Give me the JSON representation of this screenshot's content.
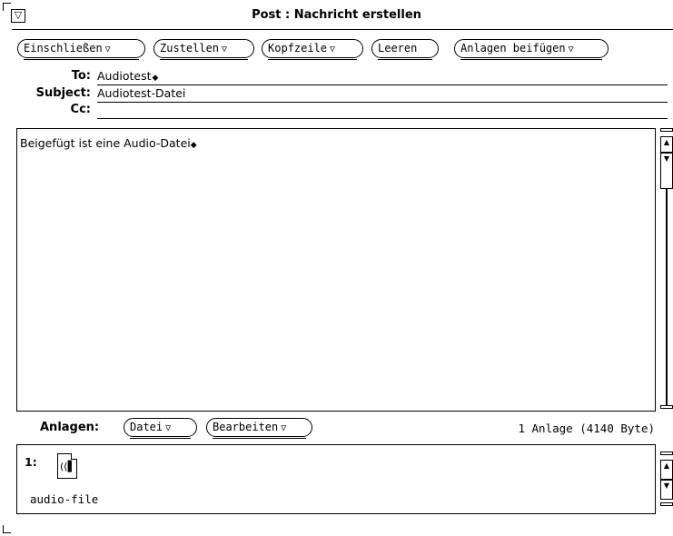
{
  "window": {
    "title": "Post : Nachricht erstellen",
    "menu_glyph": "▽"
  },
  "toolbar": {
    "buttons": [
      {
        "label": "Einschließen",
        "menu": true
      },
      {
        "label": "Zustellen",
        "menu": true
      },
      {
        "label": "Kopfzeile",
        "menu": true
      },
      {
        "label": "Leeren",
        "menu": false
      },
      {
        "label": "Anlagen beifügen",
        "menu": true
      }
    ],
    "menu_arrow": "▽"
  },
  "header": {
    "to_label": "To:",
    "to_value": "Audiotest",
    "subject_label": "Subject:",
    "subject_value": "Audiotest-Datei",
    "cc_label": "Cc:",
    "cc_value": ""
  },
  "message": {
    "body": "Beigefügt ist eine Audio-Datei"
  },
  "attachments": {
    "label": "Anlagen:",
    "datei_button": "Datei",
    "bearbeiten_button": "Bearbeiten",
    "status": "1 Anlage (4140 Byte)",
    "items": [
      {
        "number": "1:",
        "name": "audio-file",
        "icon": "audio-file-icon"
      }
    ]
  }
}
